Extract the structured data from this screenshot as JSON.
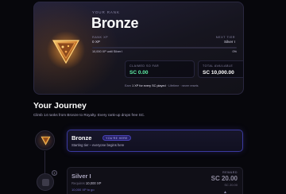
{
  "rank_card": {
    "eyebrow": "YOUR RANK",
    "rank_name": "Bronze",
    "left_label": "RANK XP",
    "left_value": "0 XP",
    "right_label": "NEXT TIER",
    "right_value": "Silver I",
    "progress_text": "10,000 XP until Silver I",
    "progress_pct": "0%",
    "progress_fraction": 0,
    "claimed_label": "CLAIMED SO FAR",
    "claimed_value": "SC 0.00",
    "total_label": "TOTAL AVAILABLE",
    "total_value": "SC 10,000.00",
    "earn_prefix": "Earn ",
    "earn_highlight": "1 XP for every SC played",
    "earn_suffix": " · Lifetime · never resets"
  },
  "journey": {
    "title": "Your Journey",
    "subtitle": "Climb 14 ranks from Bronze to Royalty. Every rank-up drops free SC."
  },
  "current_rank": {
    "name": "Bronze",
    "badge": "YOU'RE HERE",
    "description": "Starting tier – everyone begins here"
  },
  "next_rank": {
    "name": "Silver I",
    "req_prefix": "Requires ",
    "req_value": "10,000 XP",
    "hint": "10,000 XP to go",
    "reward_label": "REWARD",
    "reward_value": "SC 20.00",
    "reward_sub": "SC 20.00",
    "info": "i"
  },
  "icons": {
    "rank_badge": "bronze-rank-badge-icon",
    "timeline_badge": "bronze-rank-badge-icon",
    "locked": "lock-icon",
    "info": "info-icon",
    "reward_expand": "chevron-up-icon"
  },
  "colors": {
    "accent_gold": "#d98a2b",
    "claimed_green": "#5ff0a6",
    "current_border": "#3a3aa0",
    "badge_purple": "#4841b5"
  }
}
